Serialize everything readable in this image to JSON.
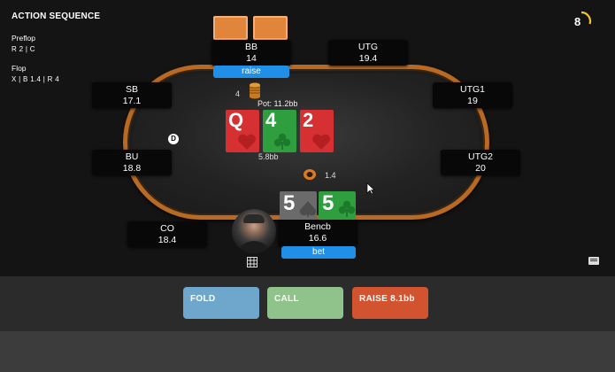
{
  "action_sequence": {
    "title": "ACTION SEQUENCE",
    "streets": [
      {
        "label": "Preflop",
        "actions": "R 2  |  C"
      },
      {
        "label": "Flop",
        "actions": "X  |  B 1.4  |  R 4"
      }
    ]
  },
  "timer": {
    "value": "8"
  },
  "seats": {
    "bb": {
      "name": "BB",
      "stack": "14",
      "tag": "raise"
    },
    "utg": {
      "name": "UTG",
      "stack": "19.4"
    },
    "sb": {
      "name": "SB",
      "stack": "17.1"
    },
    "utg1": {
      "name": "UTG1",
      "stack": "19"
    },
    "bu": {
      "name": "BU",
      "stack": "18.8"
    },
    "utg2": {
      "name": "UTG2",
      "stack": "20"
    },
    "co": {
      "name": "CO",
      "stack": "18.4"
    },
    "hero": {
      "name": "Bencb",
      "stack": "16.6",
      "tag": "bet"
    }
  },
  "table": {
    "pot": "Pot: 11.2bb",
    "bb_bet": "4",
    "board_total": "5.8bb",
    "hero_bet": "1.4",
    "dealer_button": "D"
  },
  "board": [
    {
      "rank": "Q",
      "suit": "hearts",
      "color": "#d63033"
    },
    {
      "rank": "4",
      "suit": "clubs",
      "color": "#2f9e3e"
    },
    {
      "rank": "2",
      "suit": "hearts",
      "color": "#d63033"
    }
  ],
  "hero_cards": [
    {
      "rank": "5",
      "suit": "spades",
      "color": "#6b6b6b"
    },
    {
      "rank": "5",
      "suit": "clubs",
      "color": "#2f9e3e"
    }
  ],
  "buttons": {
    "fold": "FOLD",
    "call": "CALL",
    "raise": "RAISE 8.1bb"
  },
  "colors": {
    "rail": "#b86a24",
    "action_tag": "#1f8fe8",
    "fold": "#6fa6cb",
    "call": "#8fc38b",
    "raise": "#d2532f",
    "timer_arc": "#f2c230"
  }
}
